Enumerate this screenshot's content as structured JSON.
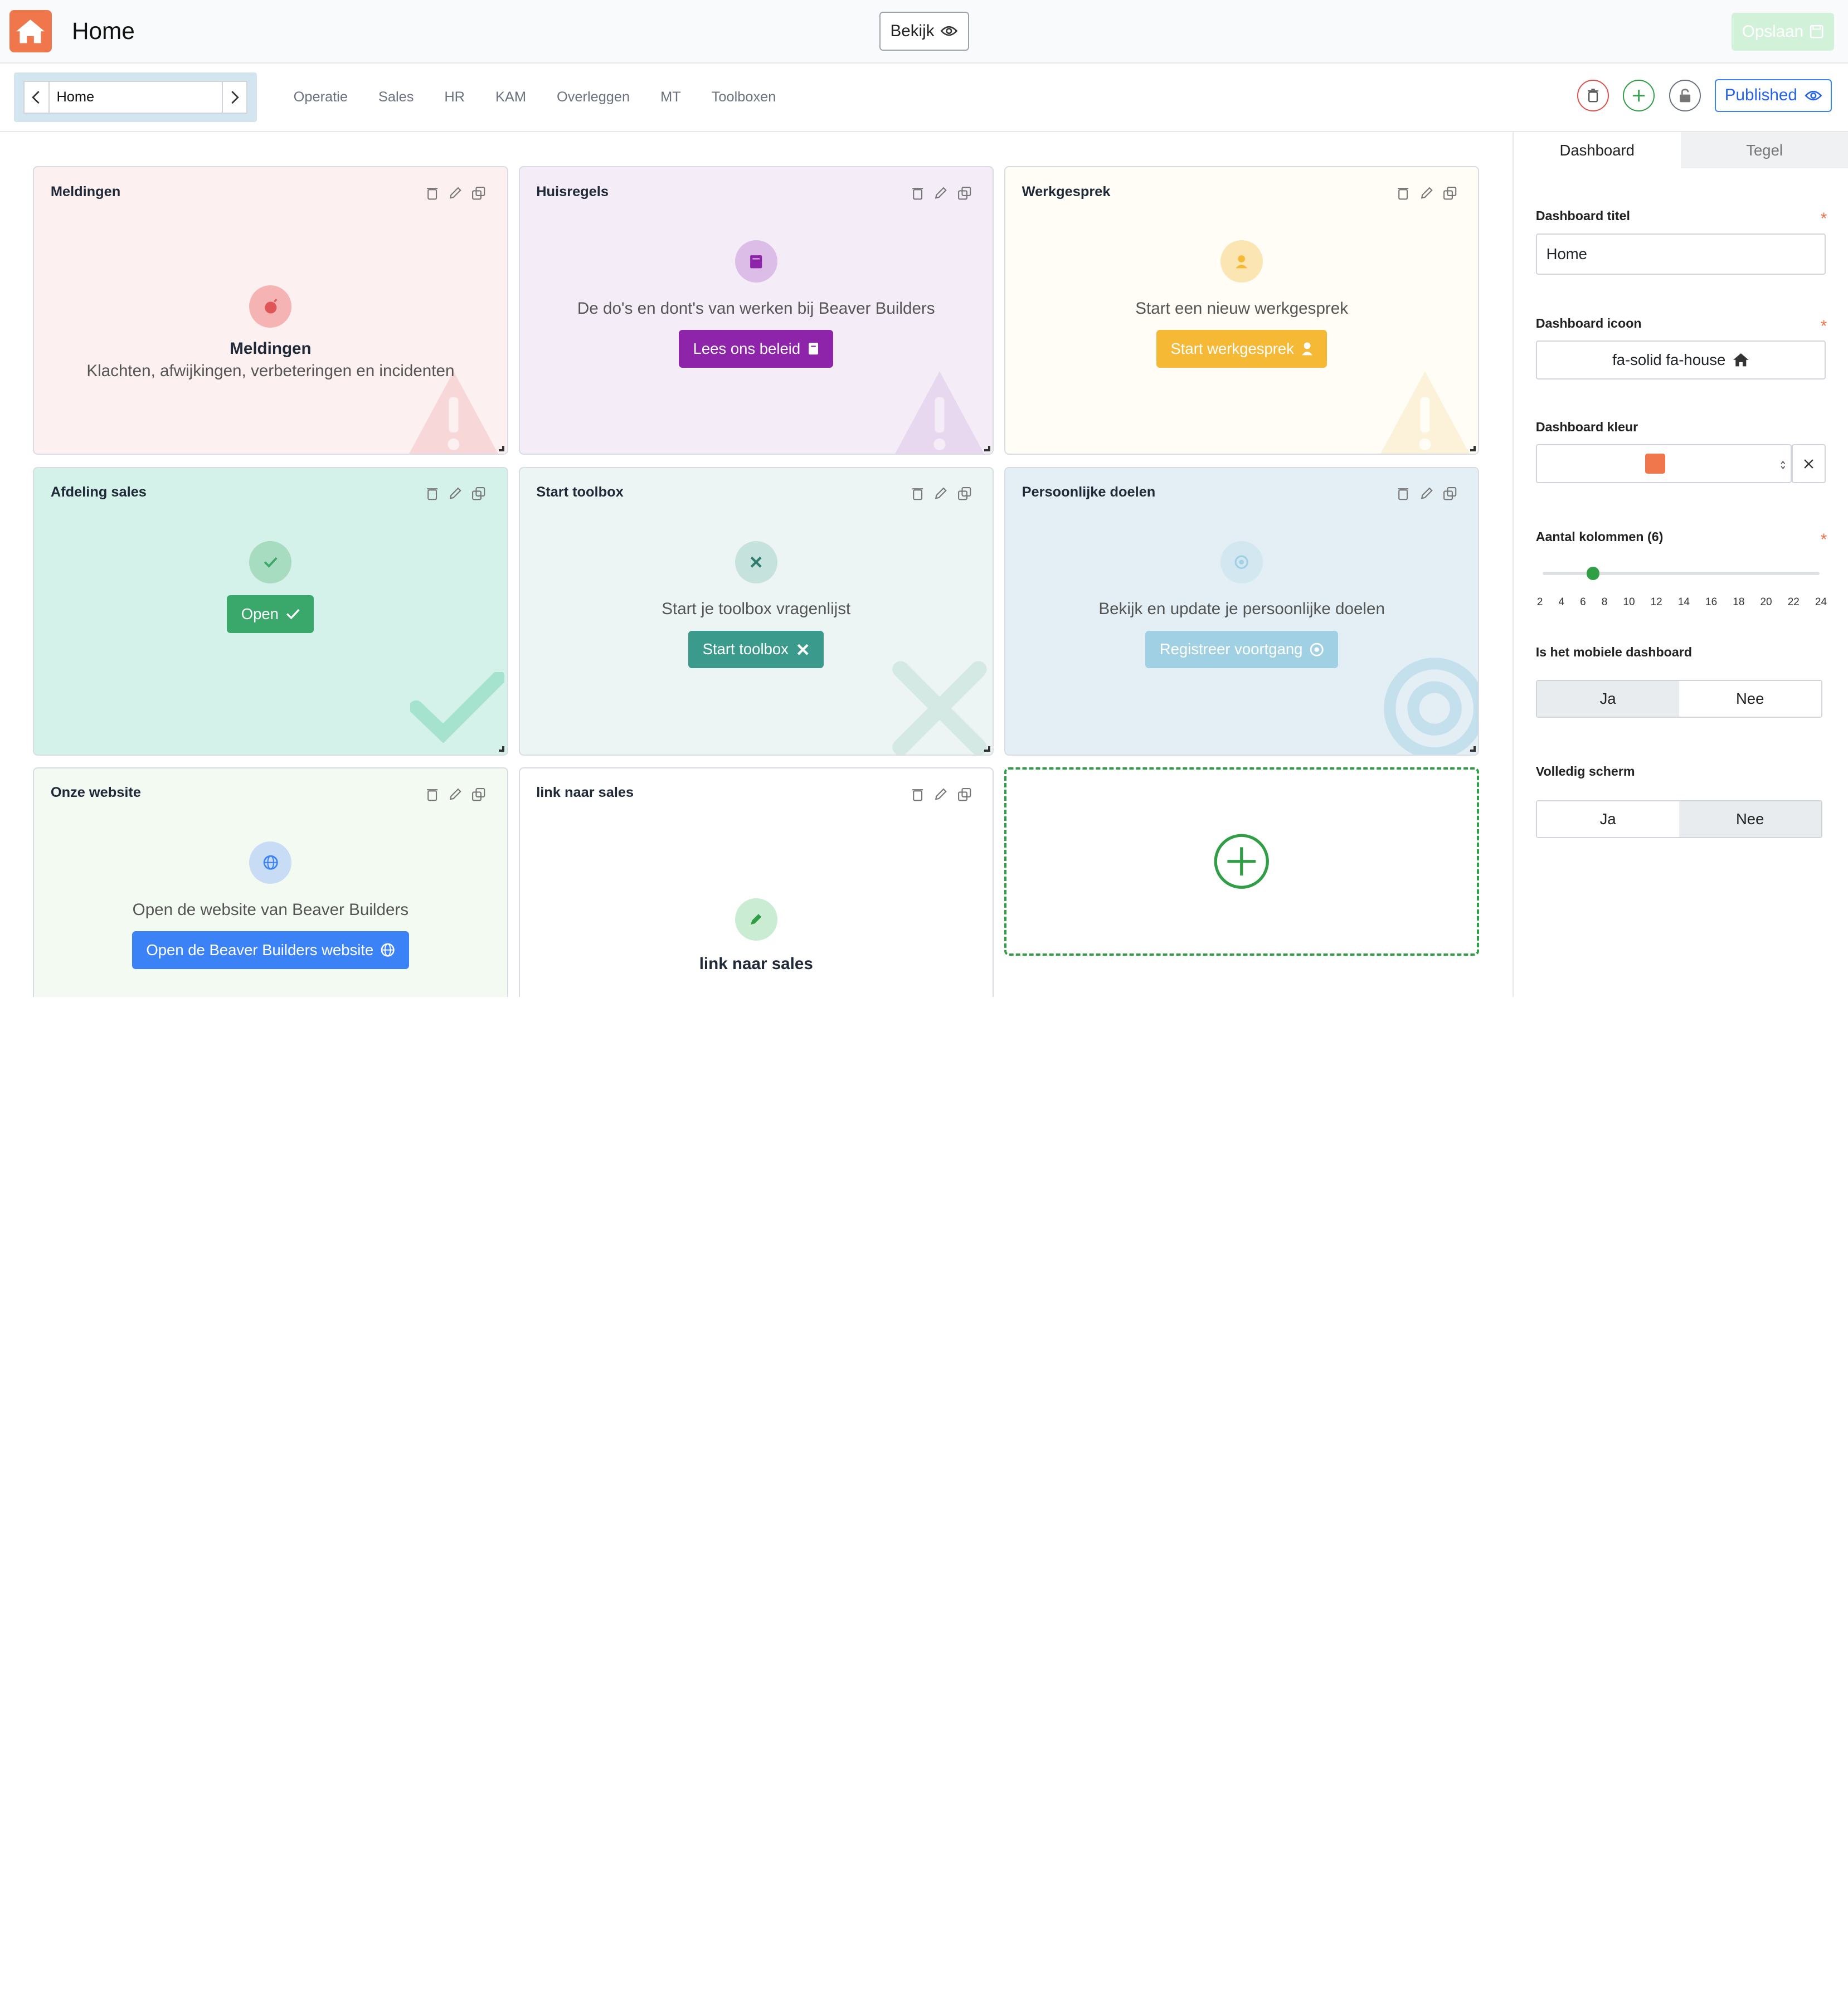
{
  "header": {
    "title": "Home",
    "view_label": "Bekijk",
    "save_label": "Opslaan",
    "brand_color": "#f0764c"
  },
  "nav": {
    "breadcrumb_current": "Home",
    "tabs": [
      "Operatie",
      "Sales",
      "HR",
      "KAM",
      "Overleggen",
      "MT",
      "Toolboxen"
    ],
    "published_label": "Published"
  },
  "tiles": [
    {
      "title": "Meldingen",
      "heading": "Meldingen",
      "description": "Klachten, afwijkingen, verbeteringen en incidenten",
      "icon": "bomb-icon",
      "bg": "#fdf0f0",
      "accent": "#f5b3b3"
    },
    {
      "title": "Huisregels",
      "description": "De do's en dont's van werken bij Beaver Builders",
      "button": "Lees ons beleid",
      "icon": "book-icon",
      "bg": "#f4ecf7",
      "button_color": "#8e24aa"
    },
    {
      "title": "Werkgesprek",
      "description": "Start een nieuw werkgesprek",
      "button": "Start werkgesprek",
      "icon": "user-tie-icon",
      "bg": "#fffdf5",
      "button_color": "#f5b935"
    },
    {
      "title": "Afdeling sales",
      "button": "Open",
      "icon": "check-icon",
      "bg": "#d4f1ea",
      "button_color": "#3aa86b"
    },
    {
      "title": "Start toolbox",
      "description": "Start je toolbox vragenlijst",
      "button": "Start toolbox",
      "icon": "tools-icon",
      "bg": "#ecf5f3",
      "button_color": "#3a9a8c"
    },
    {
      "title": "Persoonlijke doelen",
      "description": "Bekijk en update je persoonlijke doelen",
      "button": "Registreer voortgang",
      "icon": "bullseye-icon",
      "bg": "#e3eff5",
      "button_color": "#9fd0e3"
    },
    {
      "title": "Onze website",
      "description": "Open de website van Beaver Builders",
      "button": "Open de Beaver Builders website",
      "icon": "globe-icon",
      "bg": "#f3faf1",
      "button_color": "#3b82f6"
    },
    {
      "title": "link naar sales",
      "heading": "link naar sales",
      "icon": "pen-icon",
      "bg": "#ffffff"
    }
  ],
  "side": {
    "tab_dashboard": "Dashboard",
    "tab_tile": "Tegel",
    "title_label": "Dashboard titel",
    "title_value": "Home",
    "icon_label": "Dashboard icoon",
    "icon_value": "fa-solid fa-house",
    "color_label": "Dashboard kleur",
    "color_value": "#f0764c",
    "columns_label": "Aantal kolommen (6)",
    "columns_value": 6,
    "column_ticks": [
      "2",
      "4",
      "6",
      "8",
      "10",
      "12",
      "14",
      "16",
      "18",
      "20",
      "22",
      "24"
    ],
    "mobile_label": "Is het mobiele dashboard",
    "fullscreen_label": "Volledig scherm",
    "yes": "Ja",
    "no": "Nee",
    "required_mark": "*"
  }
}
